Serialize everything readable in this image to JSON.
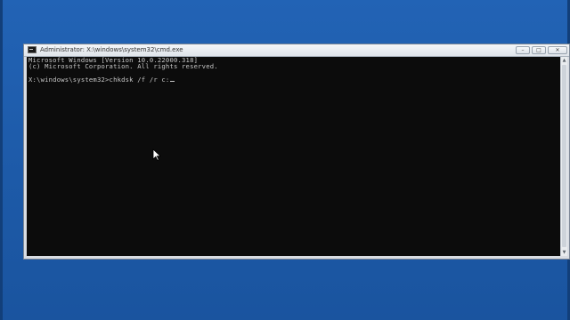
{
  "window": {
    "title": "Administrator: X:\\windows\\system32\\cmd.exe",
    "icon": "cmd-icon"
  },
  "caption_buttons": {
    "minimize_icon": "minimize-icon",
    "maximize_icon": "maximize-icon",
    "close_icon": "close-icon"
  },
  "console": {
    "lines": [
      "Microsoft Windows [Version 10.0.22000.318]",
      "(c) Microsoft Corporation. All rights reserved.",
      "",
      "X:\\windows\\system32>chkdsk /f /r c:"
    ],
    "text_color": "#c7c7c7",
    "background_color": "#0c0c0c"
  },
  "desktop": {
    "background_color": "#1f5fae"
  }
}
